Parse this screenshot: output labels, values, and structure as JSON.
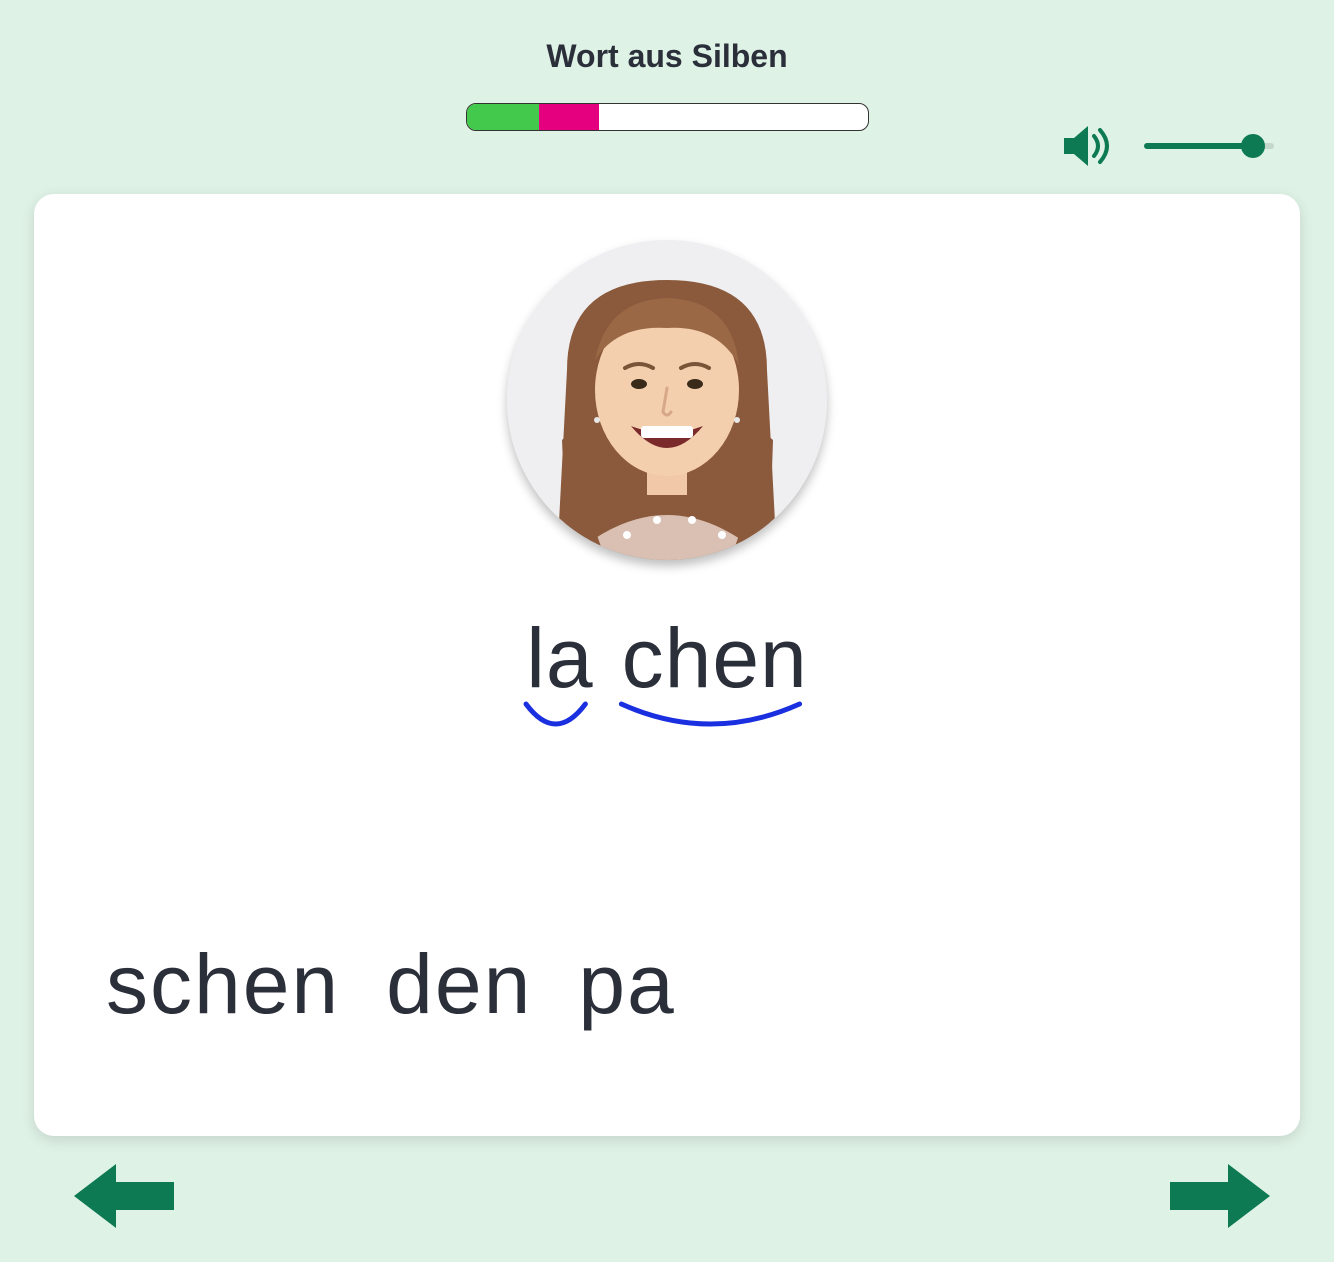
{
  "title": "Wort aus Silben",
  "progress": {
    "green_pct": 18,
    "pink_pct": 15
  },
  "audio": {
    "volume_pct": 84
  },
  "word": {
    "syllables": [
      "la",
      "chen"
    ]
  },
  "options": [
    "schen",
    "den",
    "pa"
  ],
  "colors": {
    "accent": "#0e7a54",
    "progress_green": "#43c94b",
    "progress_pink": "#e4007e",
    "arc_blue": "#1a2fe0"
  }
}
